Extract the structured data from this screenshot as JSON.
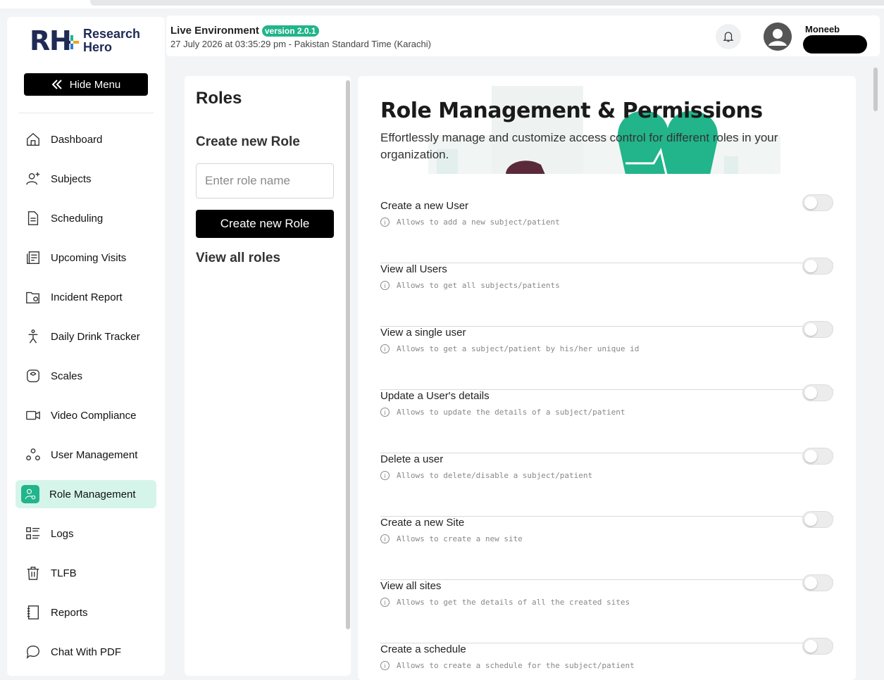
{
  "brand": {
    "mark_r": "R",
    "mark_h": "H",
    "name_line1": "Research",
    "name_line2": "Hero"
  },
  "sidebar": {
    "hide_menu_label": "Hide Menu",
    "items": [
      {
        "label": "Dashboard",
        "icon": "home-icon"
      },
      {
        "label": "Subjects",
        "icon": "user-plus-icon"
      },
      {
        "label": "Scheduling",
        "icon": "document-icon"
      },
      {
        "label": "Upcoming Visits",
        "icon": "list-doc-icon"
      },
      {
        "label": "Incident Report",
        "icon": "folder-alert-icon"
      },
      {
        "label": "Daily Drink Tracker",
        "icon": "person-icon"
      },
      {
        "label": "Scales",
        "icon": "scale-icon"
      },
      {
        "label": "Video Compliance",
        "icon": "video-icon"
      },
      {
        "label": "User Management",
        "icon": "users-icon"
      },
      {
        "label": "Role Management",
        "icon": "role-icon",
        "active": true
      },
      {
        "label": "Logs",
        "icon": "logs-icon"
      },
      {
        "label": "TLFB",
        "icon": "trash-icon"
      },
      {
        "label": "Reports",
        "icon": "notebook-icon"
      },
      {
        "label": "Chat With PDF",
        "icon": "chat-icon"
      }
    ]
  },
  "header": {
    "environment": "Live Environment",
    "version": "version 2.0.1",
    "datetime": "27 July 2026 at 03:35:29 pm - Pakistan Standard Time (Karachi)",
    "username": "Moneeb"
  },
  "roles_panel": {
    "title": "Roles",
    "create_heading": "Create new Role",
    "input_placeholder": "Enter role name",
    "create_button": "Create new Role",
    "view_all": "View all roles"
  },
  "main": {
    "title": "Role Management & Permissions",
    "description": "Effortlessly manage and customize access control for different roles in your organization.",
    "permissions": [
      {
        "title": "Create a new User",
        "info": "Allows to add a new subject/patient",
        "enabled": false
      },
      {
        "title": "View all Users",
        "info": "Allows to get all subjects/patients",
        "enabled": false
      },
      {
        "title": "View a single user",
        "info": "Allows to get a subject/patient by his/her unique id",
        "enabled": false
      },
      {
        "title": "Update a User's details",
        "info": "Allows to update the details of a subject/patient",
        "enabled": false
      },
      {
        "title": "Delete a user",
        "info": "Allows to delete/disable a subject/patient",
        "enabled": false
      },
      {
        "title": "Create a new Site",
        "info": "Allows to create a new site",
        "enabled": false
      },
      {
        "title": "View all sites",
        "info": "Allows to get the details of all the created sites",
        "enabled": false
      },
      {
        "title": "Create a schedule",
        "info": "Allows to create a schedule for the subject/patient",
        "enabled": false
      }
    ]
  },
  "colors": {
    "accent": "#22b48a",
    "active_bg": "#d6f5ea",
    "brand_navy": "#1f2a55"
  }
}
